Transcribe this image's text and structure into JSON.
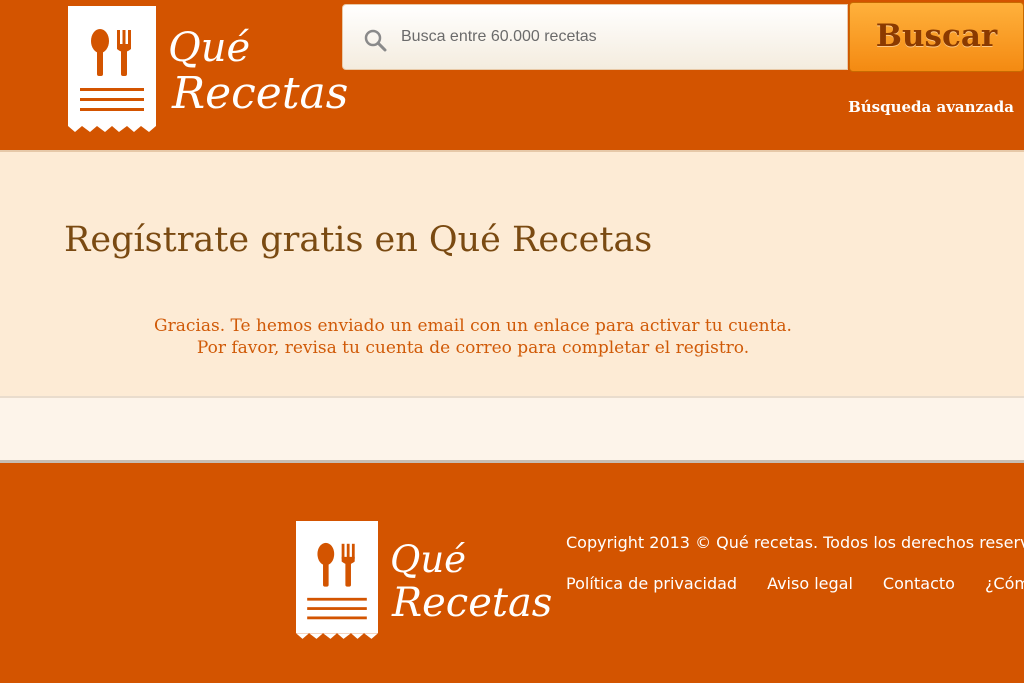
{
  "brand": {
    "logo_line1": "Qué",
    "logo_line2": "Recetas",
    "colors": {
      "primary": "#d35400",
      "accent": "#f7941d",
      "cream": "#fdebd5",
      "text_brown": "#7a4a12",
      "message_orange": "#d05a08"
    }
  },
  "header": {
    "search": {
      "placeholder": "Busca entre 60.000 recetas",
      "button_label": "Buscar",
      "icon": "search-icon"
    },
    "advanced_search": "Búsqueda avanzada"
  },
  "main": {
    "title": "Regístrate gratis en Qué Recetas",
    "message_line1": "Gracias. Te hemos enviado un email con un enlace para activar tu cuenta.",
    "message_line2": "Por favor, revisa tu cuenta de correo para completar el registro."
  },
  "footer": {
    "copyright": "Copyright 2013 © Qué recetas. Todos los derechos reserv",
    "links": [
      "Política de privacidad",
      "Aviso legal",
      "Contacto",
      "¿Cóm"
    ]
  }
}
